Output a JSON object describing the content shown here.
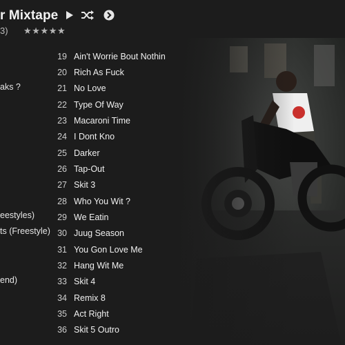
{
  "header": {
    "album_title": "r Mixtape",
    "meta_left": "3)",
    "rating": "★★★★★"
  },
  "icons": {
    "play": "play-icon",
    "shuffle": "shuffle-icon",
    "next": "next-circle-icon"
  },
  "left_column": [
    "aks ?",
    "eestyles)",
    "ts (Freestyle)",
    "end)"
  ],
  "tracks": [
    {
      "num": "19",
      "title": "Ain't Worrie Bout Nothin"
    },
    {
      "num": "20",
      "title": "Rich As Fuck"
    },
    {
      "num": "21",
      "title": "No Love"
    },
    {
      "num": "22",
      "title": "Type Of Way"
    },
    {
      "num": "23",
      "title": "Macaroni Time"
    },
    {
      "num": "24",
      "title": "I Dont Kno"
    },
    {
      "num": "25",
      "title": "Darker"
    },
    {
      "num": "26",
      "title": "Tap-Out"
    },
    {
      "num": "27",
      "title": "Skit 3"
    },
    {
      "num": "28",
      "title": "Who You Wit ?"
    },
    {
      "num": "29",
      "title": "We Eatin"
    },
    {
      "num": "30",
      "title": "Juug Season"
    },
    {
      "num": "31",
      "title": "You Gon Love Me"
    },
    {
      "num": "32",
      "title": "Hang Wit Me"
    },
    {
      "num": "33",
      "title": "Skit 4"
    },
    {
      "num": "34",
      "title": "Remix 8"
    },
    {
      "num": "35",
      "title": "Act Right"
    },
    {
      "num": "36",
      "title": "Skit 5 Outro"
    }
  ],
  "colors": {
    "background": "#1c1c1c",
    "text": "#f0f0f0",
    "muted": "#bdbdbd"
  }
}
